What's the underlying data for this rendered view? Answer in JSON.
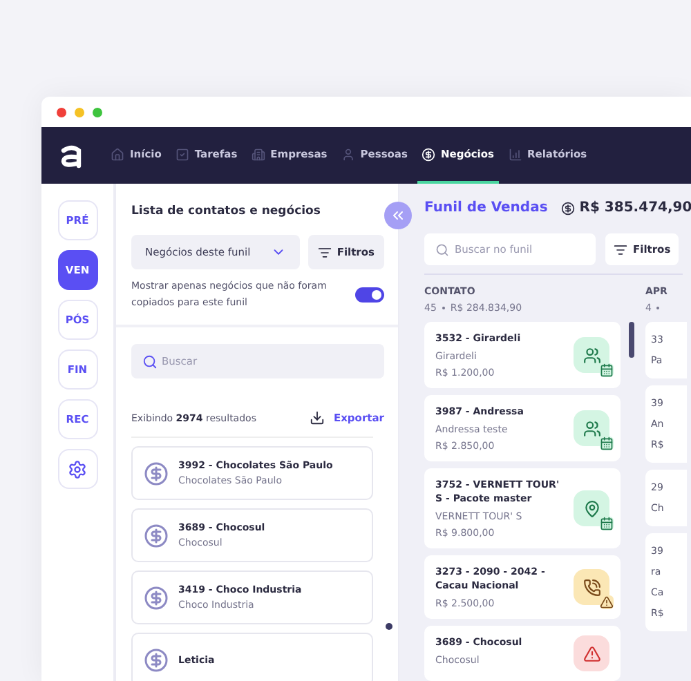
{
  "nav": {
    "items": [
      {
        "label": "Início",
        "selected": false
      },
      {
        "label": "Tarefas",
        "selected": false
      },
      {
        "label": "Empresas",
        "selected": false
      },
      {
        "label": "Pessoas",
        "selected": false
      },
      {
        "label": "Negócios",
        "selected": true
      },
      {
        "label": "Relatórios",
        "selected": false
      }
    ]
  },
  "rail": {
    "items": [
      {
        "label": "PRÉ",
        "selected": false
      },
      {
        "label": "VEN",
        "selected": true
      },
      {
        "label": "PÓS",
        "selected": false
      },
      {
        "label": "FIN",
        "selected": false
      },
      {
        "label": "REC",
        "selected": false
      }
    ]
  },
  "panel": {
    "title": "Lista de contatos e negócios",
    "dropdown": "Negócios deste funil",
    "filter_button": "Filtros",
    "toggle": {
      "label": "Mostrar apenas negócios que não foram copiados para este funil",
      "on": true
    },
    "search": {
      "placeholder": "Buscar"
    },
    "results": "Exibindo **2974** resultados",
    "export_button": "Exportar",
    "items": [
      {
        "title": "3992 - Chocolates São Paulo",
        "subtitle": "Chocolates São Paulo"
      },
      {
        "title": "3689 - Chocosul",
        "subtitle": "Chocosul"
      },
      {
        "title": "3419 - Choco Industria",
        "subtitle": "Choco Industria"
      },
      {
        "title": "Leticia"
      }
    ]
  },
  "board": {
    "title": "Funil de Vendas",
    "total": "R$ 385.474,90",
    "search": {
      "placeholder": "Buscar no funil"
    },
    "filter_button": "Filtros",
    "columns": [
      {
        "name": "CONTATO",
        "count": "45",
        "amount": "R$ 284.834,90",
        "cards": [
          {
            "title": "3532 - Girardeli",
            "subtitle": "Girardeli",
            "value": "R$ 1.200,00",
            "kind": "meeting"
          },
          {
            "title": "3987 - Andressa",
            "subtitle": "Andressa teste",
            "value": "R$ 2.850,00",
            "kind": "meeting"
          },
          {
            "title": "3752 - VERNETT TOUR' S - Pacote master",
            "subtitle": "VERNETT TOUR' S",
            "value": "R$ 9.800,00",
            "kind": "visit"
          },
          {
            "title": "3273 - 2090 - 2042 - Cacau Nacional",
            "value": "R$ 2.500,00",
            "kind": "call_warning"
          },
          {
            "title": "3689 - Chocosul",
            "subtitle": "Chocosul",
            "kind": "alert"
          }
        ]
      },
      {
        "name": "APR",
        "count": "4",
        "cards": [
          {
            "lines": [
              "33",
              "Pa"
            ]
          },
          {
            "lines": [
              "39",
              "An",
              "R$"
            ]
          },
          {
            "lines": [
              "29",
              "Ch"
            ]
          },
          {
            "lines": [
              "39",
              "ra",
              "Ca",
              "R$"
            ]
          }
        ]
      }
    ]
  }
}
